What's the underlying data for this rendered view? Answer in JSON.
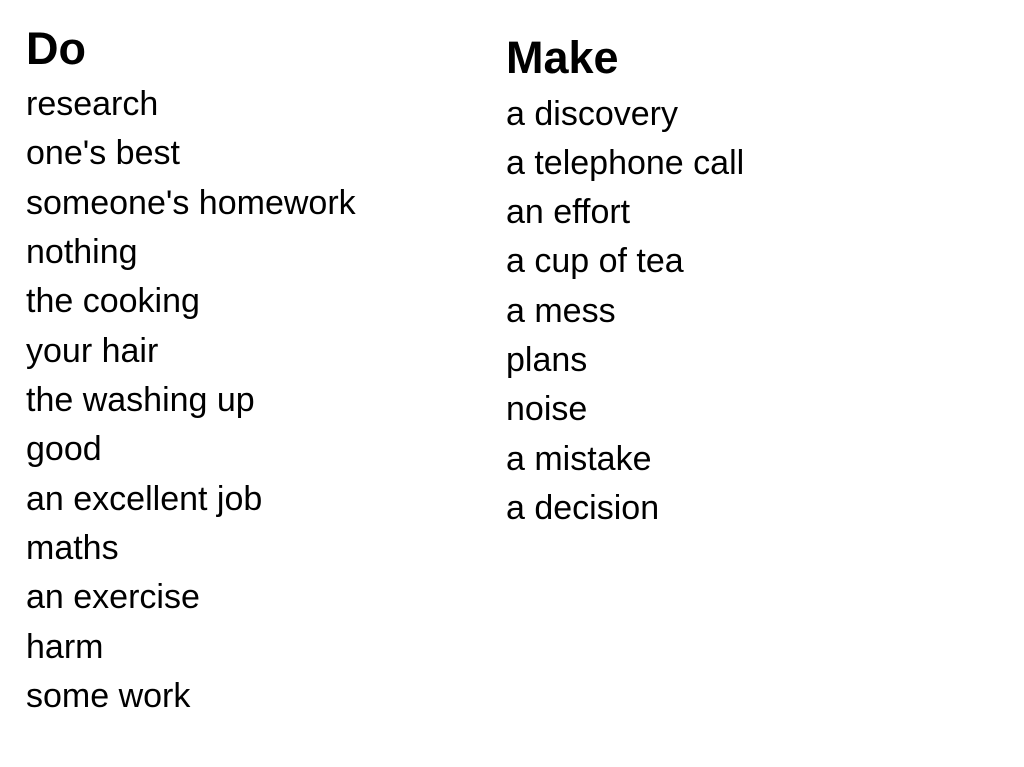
{
  "do": {
    "heading": "Do",
    "items": [
      "research",
      "one's best",
      "someone's homework",
      "nothing",
      "the cooking",
      "your hair",
      "the washing up",
      "good",
      "an excellent job",
      "maths",
      "an exercise",
      "harm",
      "some work"
    ]
  },
  "make": {
    "heading": "Make",
    "items": [
      "a discovery",
      "a telephone call",
      "an effort",
      "a cup of tea",
      "a mess",
      "plans",
      "noise",
      "a mistake",
      "a decision"
    ]
  }
}
